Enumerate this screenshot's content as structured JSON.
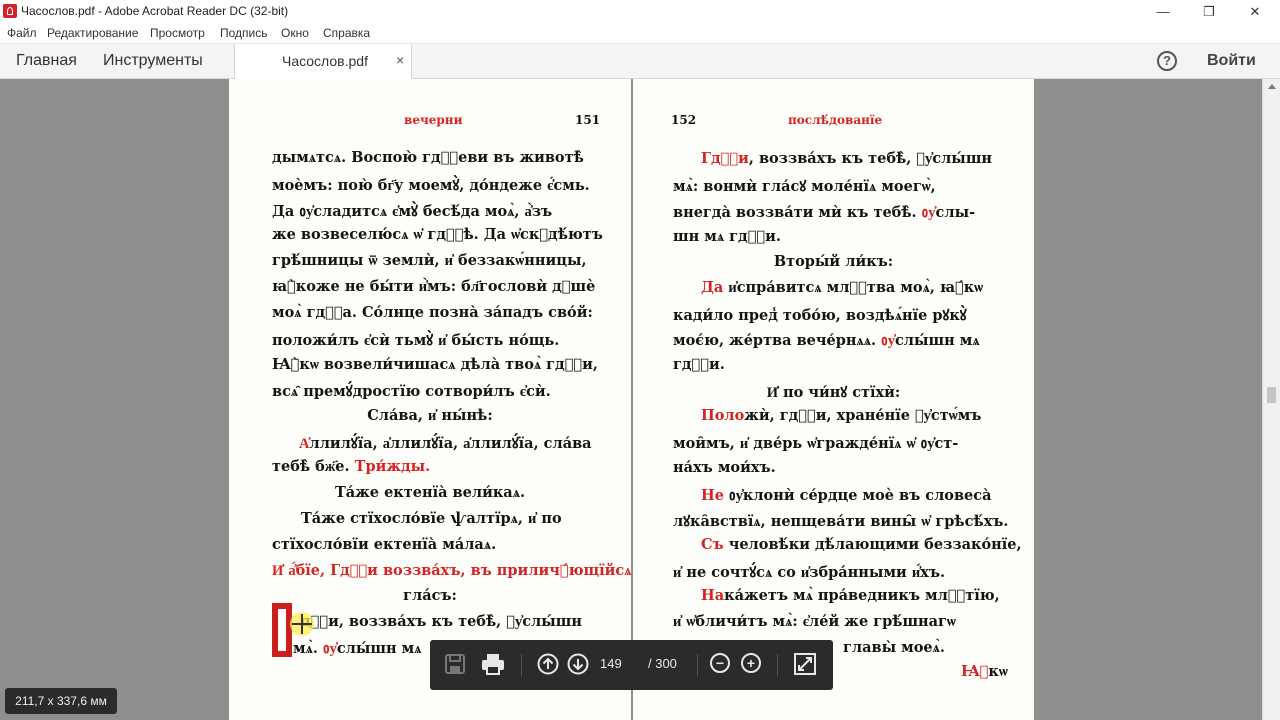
{
  "window": {
    "title": "Часослов.pdf - Adobe Acrobat Reader DC (32-bit)",
    "minimize_label": "—",
    "maximize_label": "❐",
    "close_label": "✕"
  },
  "menu": [
    "Файл",
    "Редактирование",
    "Просмотр",
    "Подпись",
    "Окно",
    "Справка"
  ],
  "tabs": {
    "home": "Главная",
    "tools": "Инструменты",
    "document": "Часослов.pdf",
    "close": "×",
    "help": "?",
    "login": "Войти"
  },
  "left_page": {
    "header_title": "вечерни",
    "page_number": "151",
    "lines": [
      "дымѧтсѧ. Воспою̀ гдⷭ҇еви въ животѣ̀",
      "моѐмъ: пою̀ бг҃у моемꙋ̀, до́ндеже є҆́смь.",
      "Да ᲂу҆сладитсѧ є҆мꙋ̀ бесѣ́да моѧ̀, а҆̀зъ",
      "же возвеселю́сѧ ѡ҆ гдⷭ҇ѣ. Да ѡ҆скꙋдѣ́ютъ",
      "грѣ́шницы ѿ землѝ, и҆ беззакѡ́нницы,",
      "ꙗ҆̀коже не бы́ти и҆̀мъ: бл҃гословѝ дꙋшѐ",
      "моѧ̀ гдⷭ҇а. Со́лнце позна̀ за́падъ сво́й:",
      "положи́лъ є҆сѝ тьмꙋ̀ и҆ бы́сть но́щь.",
      "Ꙗ҆̀кѡ возвели́чишасѧ дѣла̀ твоѧ̀ гдⷭ҇и,",
      "всѧ̑ премꙋ́дростїю сотвори́лъ є҆сѝ."
    ],
    "slava": "Сла́ва, и҆ ны́нѣ:",
    "alleluia_red": "А҆",
    "alleluia_line1": "ллилꙋ́їа, а҆ллилꙋ́їа, а҆ллилꙋ́їа, сла́ва",
    "alleluia_line2": "тебѣ̀ бж҃е.",
    "trizhdy": "Три́жды.",
    "ektenia": "Та́же ектенїа̀ вели́каѧ.",
    "stikh1": "Та́же стїхосло́вїе ѱалтїрѧ, и҆ по",
    "stikh2": "стїхосло́вїи ектенїа̀ ма́лаѧ.",
    "abie_red": "И҆ а҆́бїе, Гдⷭ҇и воззва́хъ,",
    "abie_black": "въ приличꙋ́ющїйсѧ",
    "glas": "гла́съ:",
    "last1": "дⷭ҇и, воззва́хъ къ тебѣ̀, ᲂу҆слы́шн",
    "last2_black": "мѧ̀.",
    "last2_red": "ᲂу҆",
    "last2_rest": "слы́шн мѧ"
  },
  "right_page": {
    "page_number": "152",
    "header_title": "послѣ́дованїе",
    "p1_red": "Гдⷭ҇и",
    "p1_l1": ", воззва́хъ къ тебѣ̀, ᲂу҆слы́шн",
    "p1_l2": "мѧ̀: вонмѝ гла́сꙋ моле́нїѧ моегѡ̀,",
    "p1_l3_black": "внегда̀ воззва́ти мѝ къ тебѣ̀.",
    "p1_l3_red": "ᲂу҆",
    "p1_l3_rest": "слы-",
    "p1_l4": "шн мѧ гдⷭ҇и.",
    "vtoryi": "Вторы́й ли́къ:",
    "p2_red": "Да",
    "p2_l1": " и҆спра́витсѧ млⷭ҇тва моѧ̀, ꙗ҆́кѡ",
    "p2_l2": "кади́ло пред̾ тобо́ю, воздѣѧ́нїе рꙋкꙋ̀",
    "p2_l3_black": "моє́ю, же́ртва вече́рнѧѧ.",
    "p2_l3_red": "ᲂу҆",
    "p2_l3_rest": "слы́шн мѧ",
    "p2_l4": "гдⷭ҇и.",
    "po_chinu": "И҆ по чи́нꙋ стїхѝ:",
    "p3_red": "Поло",
    "p3_l1": "жѝ, гдⷭ҇и, хране́нїе ᲂу҆стѡ́мъ",
    "p3_l2": "мои̑мъ, и҆ две́рь ѡ҆гражде́нїѧ ѡ҆ ᲂу҆ст-",
    "p3_l3": "на́хъ мои́хъ.",
    "p4_red": "Не",
    "p4_l1": " ᲂу҆клонѝ се́рдце моѐ въ словеса̀",
    "p4_l2": "лꙋка̑вствїѧ, непщева́ти вины̑ ѡ҆ грѣсѣ́хъ.",
    "p5_red": "Съ",
    "p5_l1": " человѣ́ки дѣ́лающими беззако́нїе,",
    "p5_l2": "и҆ не сочтꙋ́сѧ со и҆збра́нными и҆́хъ.",
    "p6_red": "На",
    "p6_l1": "ка́жетъ мѧ̀ пра́ведникъ млⷭ҇тїю,",
    "p6_l2": "и҆ ѡ҆бличи́тъ мѧ̀: є҆ле́й же грѣ́шнагѡ",
    "p6_l3": "главы̀ моеѧ̀.",
    "p7_red": "Ꙗ҆",
    "p7_rest": "кѡ"
  },
  "toolbar": {
    "current_page": "149",
    "total_pages": "/ 300",
    "zoom_out": "−",
    "zoom_in": "+"
  },
  "page_size": "211,7 x 337,6 мм"
}
